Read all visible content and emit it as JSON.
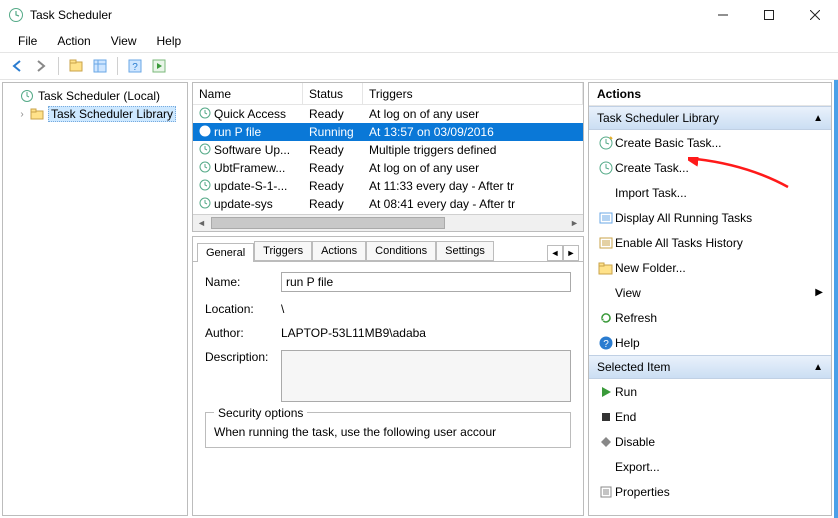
{
  "window": {
    "title": "Task Scheduler"
  },
  "menubar": [
    "File",
    "Action",
    "View",
    "Help"
  ],
  "tree": {
    "root": "Task Scheduler (Local)",
    "child": "Task Scheduler Library"
  },
  "tasklist": {
    "columns": {
      "name": "Name",
      "status": "Status",
      "triggers": "Triggers"
    },
    "col_widths": {
      "name": 110,
      "status": 60,
      "triggers": 210
    },
    "rows": [
      {
        "name": "Quick Access",
        "status": "Ready",
        "triggers": "At log on of any user",
        "selected": false
      },
      {
        "name": "run P file",
        "status": "Running",
        "triggers": "At 13:57 on 03/09/2016",
        "selected": true
      },
      {
        "name": "Software Up...",
        "status": "Ready",
        "triggers": "Multiple triggers defined",
        "selected": false
      },
      {
        "name": "UbtFramew...",
        "status": "Ready",
        "triggers": "At log on of any user",
        "selected": false
      },
      {
        "name": "update-S-1-...",
        "status": "Ready",
        "triggers": "At 11:33 every day - After tr",
        "selected": false
      },
      {
        "name": "update-sys",
        "status": "Ready",
        "triggers": "At 08:41 every day - After tr",
        "selected": false
      }
    ]
  },
  "tabs": [
    "General",
    "Triggers",
    "Actions",
    "Conditions",
    "Settings"
  ],
  "detail": {
    "nameLabel": "Name:",
    "nameValue": "run P file",
    "locationLabel": "Location:",
    "locationValue": "\\",
    "authorLabel": "Author:",
    "authorValue": "LAPTOP-53L11MB9\\adaba",
    "descLabel": "Description:",
    "secLegend": "Security options",
    "secText": "When running the task, use the following user accour"
  },
  "actions": {
    "panelTitle": "Actions",
    "section1": "Task Scheduler Library",
    "section2": "Selected Item",
    "items1": [
      {
        "icon": "wizard",
        "label": "Create Basic Task..."
      },
      {
        "icon": "task",
        "label": "Create Task..."
      },
      {
        "icon": "none",
        "label": "Import Task..."
      },
      {
        "icon": "list",
        "label": "Display All Running Tasks"
      },
      {
        "icon": "history",
        "label": "Enable All Tasks History"
      },
      {
        "icon": "folder",
        "label": "New Folder..."
      },
      {
        "icon": "none",
        "label": "View",
        "expand": true
      },
      {
        "icon": "refresh",
        "label": "Refresh"
      },
      {
        "icon": "help",
        "label": "Help"
      }
    ],
    "items2": [
      {
        "icon": "run",
        "label": "Run"
      },
      {
        "icon": "end",
        "label": "End"
      },
      {
        "icon": "disable",
        "label": "Disable"
      },
      {
        "icon": "none",
        "label": "Export..."
      },
      {
        "icon": "props",
        "label": "Properties"
      }
    ]
  }
}
